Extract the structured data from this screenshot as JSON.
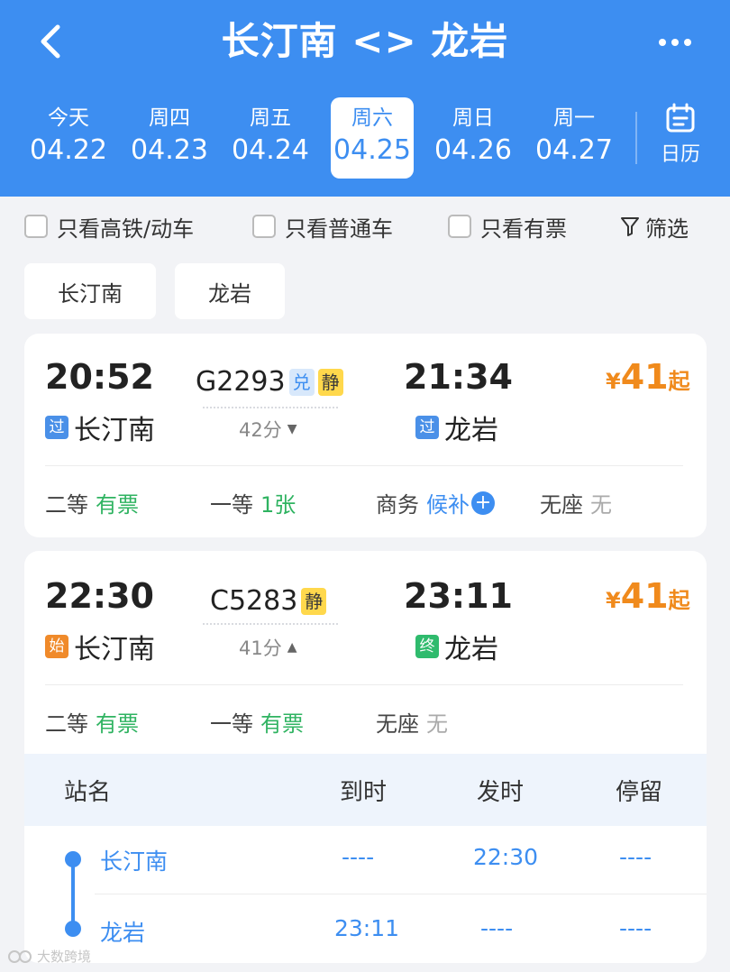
{
  "header": {
    "title": "长汀南 <> 龙岩",
    "dates": [
      {
        "weekday": "今天",
        "date": "04.22",
        "active": false
      },
      {
        "weekday": "周四",
        "date": "04.23",
        "active": false
      },
      {
        "weekday": "周五",
        "date": "04.24",
        "active": false
      },
      {
        "weekday": "周六",
        "date": "04.25",
        "active": true
      },
      {
        "weekday": "周日",
        "date": "04.26",
        "active": false
      },
      {
        "weekday": "周一",
        "date": "04.27",
        "active": false
      }
    ],
    "calendar_label": "日历",
    "accent_color": "#3d8ef1"
  },
  "filters": {
    "high_speed_only": "只看高铁/动车",
    "regular_only": "只看普通车",
    "available_only": "只看有票",
    "filter_label": "筛选"
  },
  "station_chips": [
    "长汀南",
    "龙岩"
  ],
  "trains": [
    {
      "dep_time": "20:52",
      "dep_tag": "过",
      "dep_station": "长汀南",
      "train_no": "G2293",
      "badges": [
        "兑",
        "静"
      ],
      "duration": "42分",
      "arr_time": "21:34",
      "arr_tag": "过",
      "arr_station": "龙岩",
      "price_currency": "¥",
      "price": "41",
      "price_suffix": "起",
      "seats": [
        {
          "name": "二等",
          "value": "有票"
        },
        {
          "name": "一等",
          "value": "1张"
        },
        {
          "name": "商务",
          "value": "候补"
        },
        {
          "name": "无座",
          "value": "无"
        }
      ]
    },
    {
      "dep_time": "22:30",
      "dep_tag": "始",
      "dep_station": "长汀南",
      "train_no": "C5283",
      "badges": [
        "静"
      ],
      "duration": "41分",
      "arr_time": "23:11",
      "arr_tag": "终",
      "arr_station": "龙岩",
      "price_currency": "¥",
      "price": "41",
      "price_suffix": "起",
      "seats": [
        {
          "name": "二等",
          "value": "有票"
        },
        {
          "name": "一等",
          "value": "有票"
        },
        {
          "name": "无座",
          "value": "无"
        }
      ]
    }
  ],
  "stops": {
    "headers": [
      "站名",
      "到时",
      "发时",
      "停留"
    ],
    "rows": [
      {
        "station": "长汀南",
        "arrive": "----",
        "depart": "22:30",
        "stay": "----"
      },
      {
        "station": "龙岩",
        "arrive": "23:11",
        "depart": "----",
        "stay": "----"
      }
    ]
  },
  "watermark": "大数跨境"
}
